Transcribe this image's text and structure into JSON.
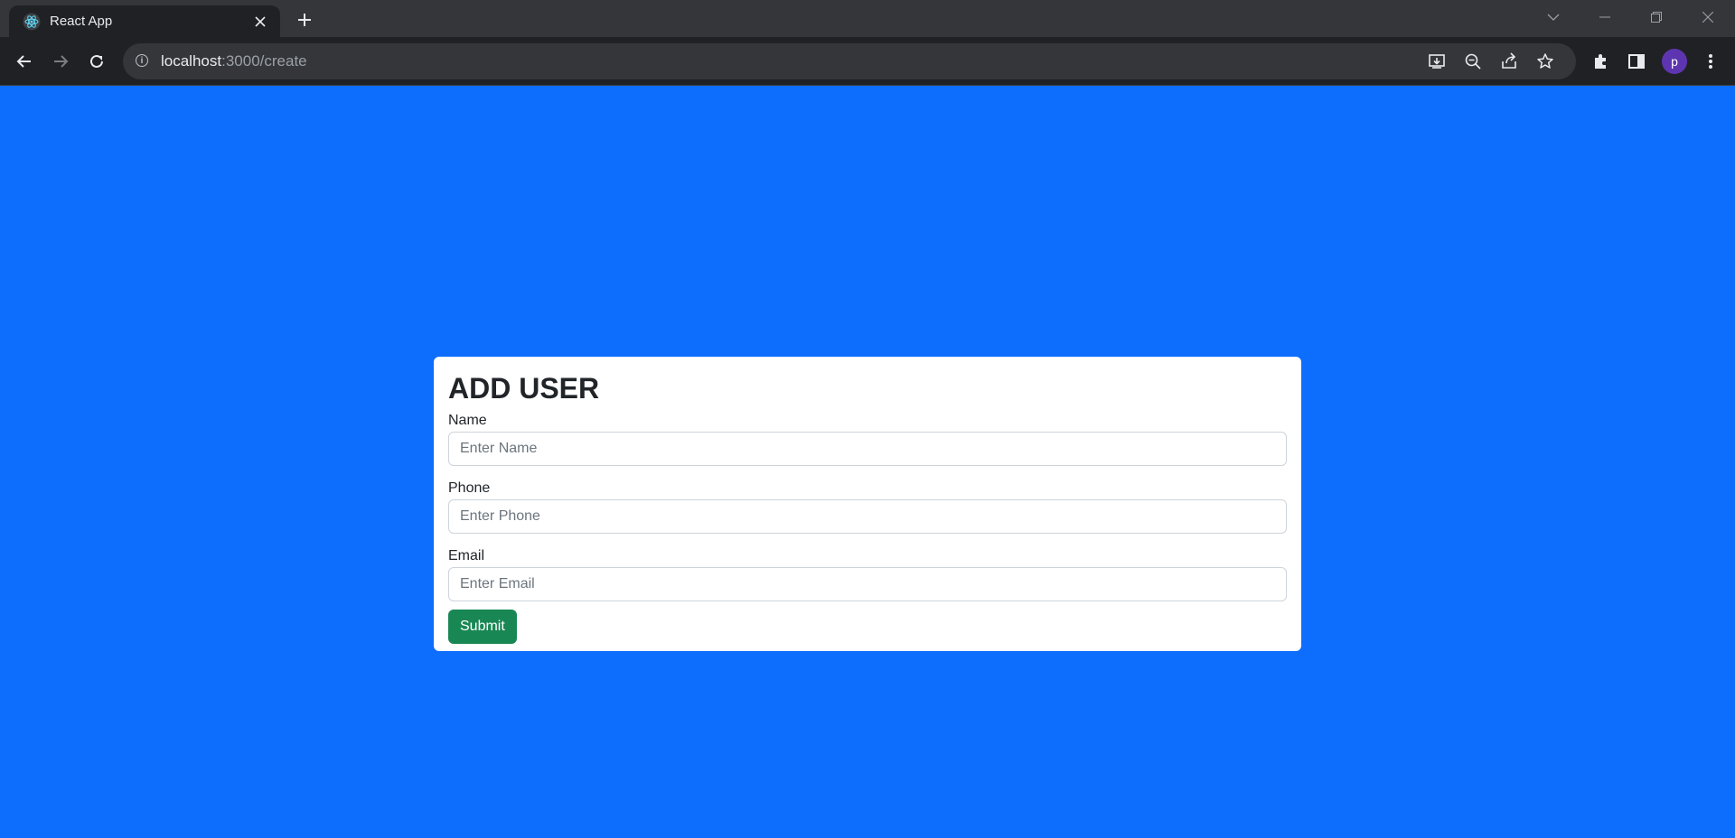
{
  "browser": {
    "tab_title": "React App",
    "url_host": "localhost",
    "url_path": ":3000/create",
    "avatar_letter": "p",
    "icons": [
      "react-icon",
      "close-icon",
      "plus-icon",
      "back-icon",
      "forward-icon",
      "reload-icon",
      "info-icon",
      "install-icon",
      "zoom-out-icon",
      "share-icon",
      "star-icon",
      "extensions-icon",
      "side-panel-icon",
      "menu-icon"
    ]
  },
  "form": {
    "title": "ADD USER",
    "fields": [
      {
        "label": "Name",
        "placeholder": "Enter Name"
      },
      {
        "label": "Phone",
        "placeholder": "Enter Phone"
      },
      {
        "label": "Email",
        "placeholder": "Enter Email"
      }
    ],
    "submit_label": "Submit"
  },
  "colors": {
    "page_background": "#0d6efd",
    "submit_button": "#198754",
    "avatar": "#5e35b1"
  }
}
